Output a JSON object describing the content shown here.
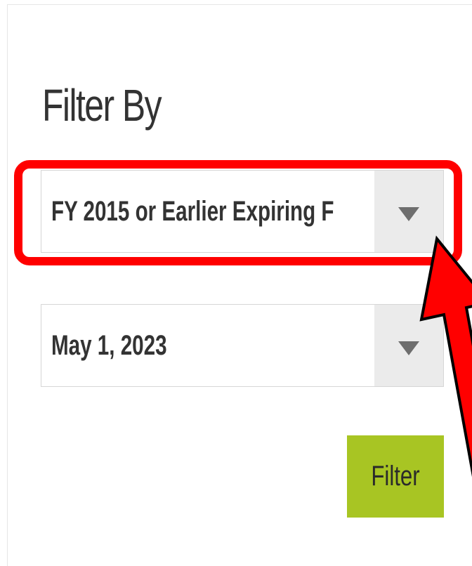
{
  "filter_panel": {
    "heading": "Filter By",
    "period_select": {
      "selected": "FY 2015 or Earlier Expiring F",
      "arrow_icon": "triangle-down-icon"
    },
    "date_select": {
      "selected": "May 1, 2023",
      "arrow_icon": "triangle-down-icon"
    },
    "filter_button_label": "Filter"
  },
  "annotation": {
    "highlight_color": "#ff0000",
    "arrow_color": "#ff0000"
  },
  "colors": {
    "button_bg": "#a8c523",
    "select_arrow_bg": "#ebebeb",
    "text": "#333333"
  }
}
